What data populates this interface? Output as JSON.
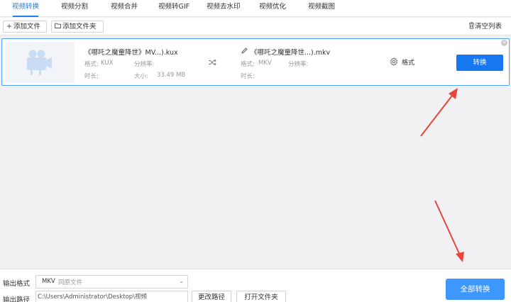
{
  "tabs": [
    "视频转换",
    "视频分割",
    "视频合并",
    "视频转GIF",
    "视频去水印",
    "视频优化",
    "视频截图"
  ],
  "toolbar": {
    "add_file": "添加文件",
    "add_folder": "添加文件夹",
    "clear_list": "清空列表"
  },
  "file": {
    "source_name": "《哪吒之魔童降世》MV...).kux",
    "source_format_label": "格式:",
    "source_format": "KUX",
    "source_resolution_label": "分辨率:",
    "source_duration_label": "时长:",
    "source_size_label": "大小:",
    "source_size": "33.49 MB",
    "target_name": "《哪吒之魔童降世...).mkv",
    "target_format_label": "格式:",
    "target_format": "MKV",
    "target_resolution_label": "分辨率:",
    "target_duration_label": "时长:",
    "format_settings": "格式",
    "convert": "转换"
  },
  "bottom": {
    "output_format_label": "输出格式",
    "output_format_value": "MKV",
    "output_format_sub": "同原文件",
    "output_path_label": "输出路径",
    "output_path_value": "C:\\Users\\Administrator\\Desktop\\视频",
    "change_path": "更改路径",
    "open_folder": "打开文件夹",
    "convert_all": "全部转换"
  },
  "colors": {
    "accent": "#1677f0",
    "convert_all_bg": "#3d97ff",
    "annotation_arrow": "#e8453c"
  }
}
